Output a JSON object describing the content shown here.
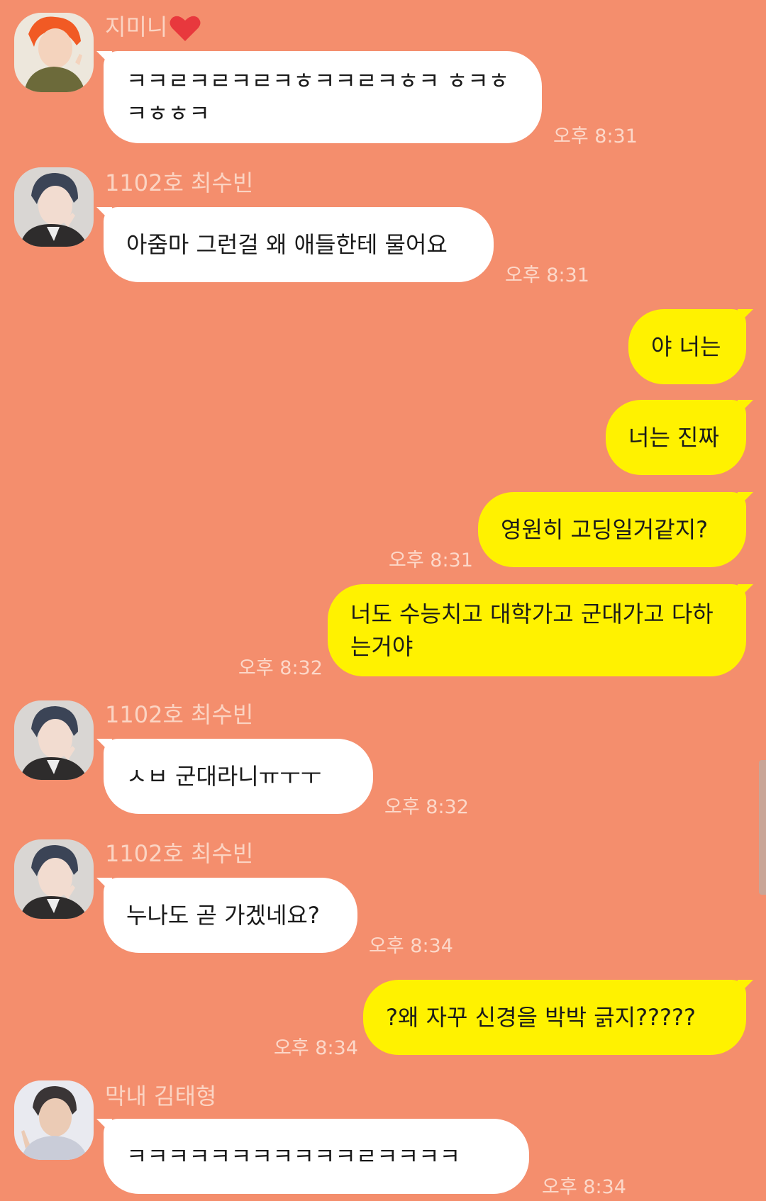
{
  "colors": {
    "background": "#F48E6D",
    "incoming_bubble": "#FFFFFF",
    "outgoing_bubble": "#FFF200",
    "sender_name": "#FBD4C3",
    "timestamp": "#FCD8C9"
  },
  "messages": [
    {
      "sender": "지미니",
      "sender_icon": "heart-icon",
      "text": "ㅋㅋㄹㅋㄹㅋㄹㅋㅎㅋㅋㄹㅋㅎㅋ ㅎㅋㅎㅋㅎㅎㅋ",
      "time": "오후 8:31"
    },
    {
      "sender": "1102호 최수빈",
      "text": "아줌마 그런걸 왜 애들한테 물어요",
      "time": "오후 8:31"
    },
    {
      "text": "야 너는"
    },
    {
      "text": "너는 진짜"
    },
    {
      "text": "영원히 고딩일거같지?",
      "time": "오후 8:31"
    },
    {
      "text": "너도 수능치고 대학가고 군대가고 다하는거야",
      "time": "오후 8:32"
    },
    {
      "sender": "1102호 최수빈",
      "text": "ㅅㅂ 군대라니ㅠㅜㅜ",
      "time": "오후 8:32"
    },
    {
      "sender": "1102호 최수빈",
      "text": "누나도 곧 가겠네요?",
      "time": "오후 8:34"
    },
    {
      "text": "?왜 자꾸 신경을 박박 긁지?????",
      "time": "오후 8:34"
    },
    {
      "sender": "막내 김태형",
      "text": "ㅋㅋㅋㅋㅋㅋㅋㅋㅋㅋㅋㄹㅋㅋㅋㅋ",
      "time": "오후 8:34"
    }
  ]
}
